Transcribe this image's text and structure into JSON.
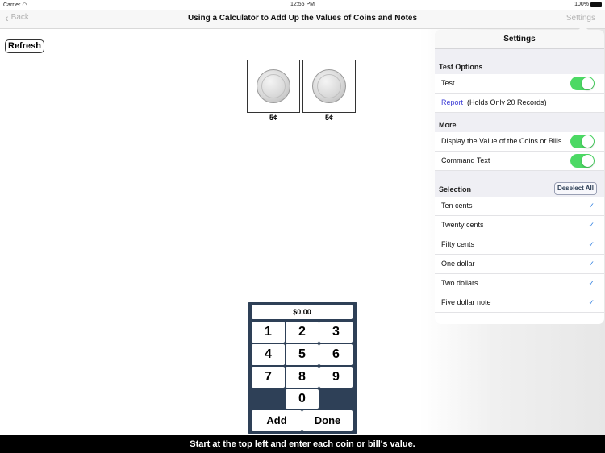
{
  "status_bar": {
    "carrier": "Carrier",
    "wifi_icon": "wifi-icon",
    "time": "12:55 PM",
    "battery": "100%",
    "battery_icon": "battery-icon"
  },
  "nav": {
    "back_label": "Back",
    "back_icon": "chevron-left-icon",
    "title": "Using a Calculator to Add Up  the Values of Coins and Notes",
    "settings_label": "Settings"
  },
  "toolbar": {
    "refresh_label": "Refresh"
  },
  "coins": [
    {
      "label": "5¢",
      "icon": "five-cent-coin"
    },
    {
      "label": "5¢",
      "icon": "five-cent-coin"
    }
  ],
  "calculator": {
    "display": "$0.00",
    "keys": [
      "1",
      "2",
      "3",
      "4",
      "5",
      "6",
      "7",
      "8",
      "9",
      "0"
    ],
    "add_label": "Add",
    "done_label": "Done"
  },
  "instruction": "Start at the top left and enter each coin or bill's value.",
  "settings_popover": {
    "title": "Settings",
    "test_options": {
      "header": "Test Options",
      "test_label": "Test",
      "test_on": true,
      "report_link": "Report",
      "report_note": "(Holds Only 20 Records)"
    },
    "more": {
      "header": "More",
      "display_value_label": "Display the Value of the Coins or Bills",
      "display_value_on": true,
      "command_text_label": "Command Text",
      "command_text_on": true
    },
    "selection": {
      "header": "Selection",
      "deselect_all_label": "Deselect All",
      "items": [
        {
          "label": "Ten cents",
          "checked": true
        },
        {
          "label": "Twenty cents",
          "checked": true
        },
        {
          "label": "Fifty cents",
          "checked": true
        },
        {
          "label": "One dollar",
          "checked": true
        },
        {
          "label": "Two dollars",
          "checked": true
        },
        {
          "label": "Five dollar note",
          "checked": true
        }
      ],
      "check_mark": "✓"
    }
  }
}
